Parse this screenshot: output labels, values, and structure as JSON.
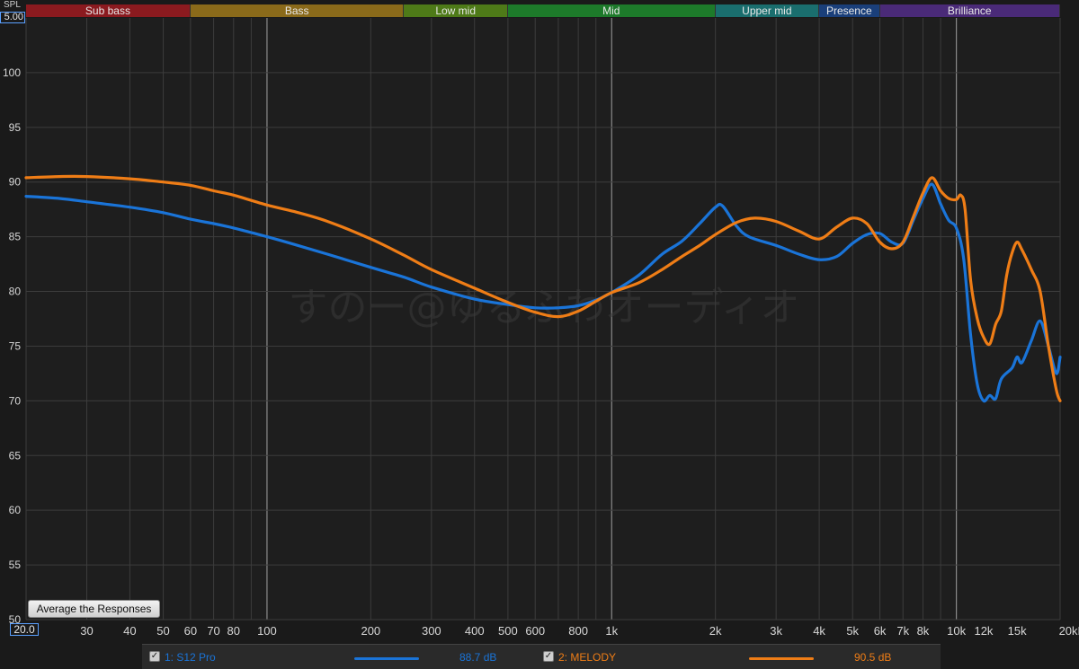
{
  "axis": {
    "y_unit_label": "SPL",
    "y_top_value": "5.00",
    "x_left_value": "20.0"
  },
  "bands": [
    {
      "label": "Sub bass",
      "from": 20,
      "to": 60,
      "color": "#8b1a1f"
    },
    {
      "label": "Bass",
      "from": 60,
      "to": 250,
      "color": "#8a6a1a"
    },
    {
      "label": "Low mid",
      "from": 250,
      "to": 500,
      "color": "#4e7a18"
    },
    {
      "label": "Mid",
      "from": 500,
      "to": 2000,
      "color": "#1d7a2a"
    },
    {
      "label": "Upper mid",
      "from": 2000,
      "to": 4000,
      "color": "#1a6e6e"
    },
    {
      "label": "Presence",
      "from": 4000,
      "to": 6000,
      "color": "#1a3f7a"
    },
    {
      "label": "Brilliance",
      "from": 6000,
      "to": 20000,
      "color": "#4a2a78"
    }
  ],
  "watermark": "すのー@ゆるふわオーディオ",
  "buttons": {
    "average": "Average the Responses"
  },
  "chart_data": {
    "type": "line",
    "x_scale": "log",
    "xlim": [
      20,
      20000
    ],
    "ylim": [
      50,
      105
    ],
    "grid": true,
    "y_ticks": [
      50,
      55,
      60,
      65,
      70,
      75,
      80,
      85,
      90,
      95,
      100
    ],
    "x_ticks": [
      {
        "value": 30,
        "label": "30"
      },
      {
        "value": 40,
        "label": "40"
      },
      {
        "value": 50,
        "label": "50"
      },
      {
        "value": 60,
        "label": "60"
      },
      {
        "value": 70,
        "label": "70"
      },
      {
        "value": 80,
        "label": "80"
      },
      {
        "value": 100,
        "label": "100"
      },
      {
        "value": 200,
        "label": "200"
      },
      {
        "value": 300,
        "label": "300"
      },
      {
        "value": 400,
        "label": "400"
      },
      {
        "value": 500,
        "label": "500"
      },
      {
        "value": 600,
        "label": "600"
      },
      {
        "value": 800,
        "label": "800"
      },
      {
        "value": 1000,
        "label": "1k"
      },
      {
        "value": 2000,
        "label": "2k"
      },
      {
        "value": 3000,
        "label": "3k"
      },
      {
        "value": 4000,
        "label": "4k"
      },
      {
        "value": 5000,
        "label": "5k"
      },
      {
        "value": 6000,
        "label": "6k"
      },
      {
        "value": 7000,
        "label": "7k"
      },
      {
        "value": 8000,
        "label": "8k"
      },
      {
        "value": 10000,
        "label": "10k"
      },
      {
        "value": 12000,
        "label": "12k"
      },
      {
        "value": 15000,
        "label": "15k"
      },
      {
        "value": 20000,
        "label": "20kHz"
      }
    ],
    "series": [
      {
        "name": "1: S12 Pro",
        "level": "88.7 dB",
        "color": "#1a74d8",
        "points": [
          [
            20,
            88.7
          ],
          [
            25,
            88.5
          ],
          [
            30,
            88.2
          ],
          [
            40,
            87.7
          ],
          [
            50,
            87.2
          ],
          [
            60,
            86.6
          ],
          [
            70,
            86.2
          ],
          [
            80,
            85.8
          ],
          [
            100,
            85.0
          ],
          [
            120,
            84.3
          ],
          [
            150,
            83.4
          ],
          [
            200,
            82.2
          ],
          [
            250,
            81.3
          ],
          [
            300,
            80.4
          ],
          [
            400,
            79.3
          ],
          [
            500,
            78.8
          ],
          [
            600,
            78.5
          ],
          [
            700,
            78.5
          ],
          [
            800,
            78.7
          ],
          [
            900,
            79.2
          ],
          [
            1000,
            79.9
          ],
          [
            1200,
            81.5
          ],
          [
            1400,
            83.4
          ],
          [
            1600,
            84.6
          ],
          [
            1800,
            86.2
          ],
          [
            2000,
            87.7
          ],
          [
            2100,
            87.8
          ],
          [
            2300,
            86.0
          ],
          [
            2500,
            85.0
          ],
          [
            3000,
            84.2
          ],
          [
            3500,
            83.4
          ],
          [
            4000,
            82.9
          ],
          [
            4500,
            83.2
          ],
          [
            5000,
            84.4
          ],
          [
            5500,
            85.2
          ],
          [
            6000,
            85.3
          ],
          [
            6500,
            84.5
          ],
          [
            7000,
            84.4
          ],
          [
            7500,
            86.5
          ],
          [
            8000,
            88.5
          ],
          [
            8500,
            89.8
          ],
          [
            9000,
            88.0
          ],
          [
            9500,
            86.5
          ],
          [
            10000,
            85.8
          ],
          [
            10500,
            83.0
          ],
          [
            11000,
            76.0
          ],
          [
            11500,
            71.5
          ],
          [
            12000,
            70.0
          ],
          [
            12500,
            70.5
          ],
          [
            13000,
            70.2
          ],
          [
            13500,
            72.0
          ],
          [
            14500,
            73.0
          ],
          [
            15000,
            74.0
          ],
          [
            15500,
            73.5
          ],
          [
            16500,
            75.5
          ],
          [
            17500,
            77.3
          ],
          [
            18500,
            75.0
          ],
          [
            19500,
            72.5
          ],
          [
            20000,
            74.0
          ]
        ]
      },
      {
        "name": "2: MELODY",
        "level": "90.5 dB",
        "color": "#ef7d16",
        "points": [
          [
            20,
            90.4
          ],
          [
            25,
            90.5
          ],
          [
            30,
            90.5
          ],
          [
            40,
            90.3
          ],
          [
            50,
            90.0
          ],
          [
            60,
            89.7
          ],
          [
            70,
            89.2
          ],
          [
            80,
            88.8
          ],
          [
            100,
            87.9
          ],
          [
            120,
            87.3
          ],
          [
            150,
            86.4
          ],
          [
            200,
            84.8
          ],
          [
            250,
            83.3
          ],
          [
            300,
            82.0
          ],
          [
            400,
            80.3
          ],
          [
            500,
            79.0
          ],
          [
            600,
            78.1
          ],
          [
            700,
            77.7
          ],
          [
            800,
            78.2
          ],
          [
            900,
            79.1
          ],
          [
            1000,
            79.9
          ],
          [
            1200,
            80.8
          ],
          [
            1400,
            82.0
          ],
          [
            1600,
            83.2
          ],
          [
            1800,
            84.2
          ],
          [
            2000,
            85.2
          ],
          [
            2300,
            86.3
          ],
          [
            2600,
            86.7
          ],
          [
            3000,
            86.4
          ],
          [
            3500,
            85.5
          ],
          [
            4000,
            84.8
          ],
          [
            4500,
            85.9
          ],
          [
            5000,
            86.7
          ],
          [
            5500,
            86.2
          ],
          [
            6000,
            84.5
          ],
          [
            6500,
            83.9
          ],
          [
            7000,
            84.5
          ],
          [
            7500,
            86.8
          ],
          [
            8000,
            89.0
          ],
          [
            8500,
            90.4
          ],
          [
            9000,
            89.2
          ],
          [
            9500,
            88.5
          ],
          [
            10000,
            88.4
          ],
          [
            10300,
            88.8
          ],
          [
            10600,
            87.5
          ],
          [
            11000,
            81.0
          ],
          [
            11500,
            77.5
          ],
          [
            12000,
            75.8
          ],
          [
            12500,
            75.2
          ],
          [
            13000,
            77.0
          ],
          [
            13500,
            78.2
          ],
          [
            14000,
            81.5
          ],
          [
            14500,
            83.5
          ],
          [
            15000,
            84.5
          ],
          [
            15500,
            83.8
          ],
          [
            16500,
            82.0
          ],
          [
            17500,
            80.0
          ],
          [
            18500,
            75.0
          ],
          [
            19500,
            71.0
          ],
          [
            20000,
            70.0
          ]
        ]
      }
    ]
  }
}
